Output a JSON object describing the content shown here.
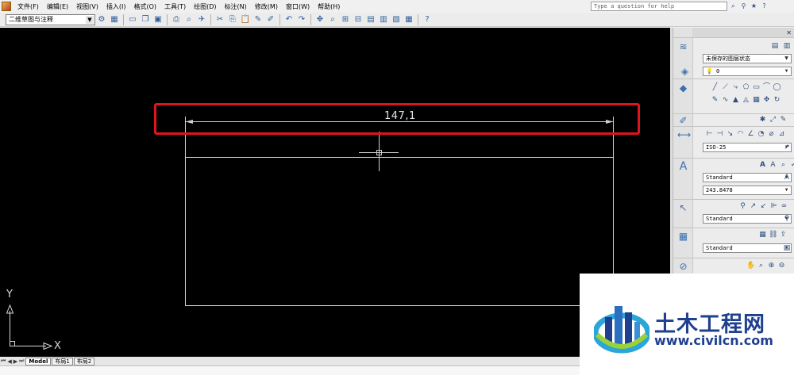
{
  "menu": {
    "items": [
      "文件(F)",
      "编辑(E)",
      "视图(V)",
      "插入(I)",
      "格式(O)",
      "工具(T)",
      "绘图(D)",
      "标注(N)",
      "修改(M)",
      "窗口(W)",
      "帮助(H)"
    ],
    "help_placeholder": "Type a question for help"
  },
  "toolbar": {
    "workspace": "二维草图与注释"
  },
  "canvas": {
    "dimension_text": "147,1",
    "ucs_x": "X",
    "ucs_y": "Y"
  },
  "tabs": {
    "model": "Model",
    "layout1": "布局1",
    "layout2": "布局2"
  },
  "panel": {
    "layer_state": "未保存的图层状态",
    "layer_current": "0",
    "dim_style": "ISO-25",
    "text_style": "Standard",
    "text_height": "243.8478",
    "mleader_style": "Standard",
    "table_style": "Standard"
  },
  "watermark": {
    "title": "土木工程网",
    "url": "www.civilcn.com"
  },
  "colors": {
    "canvas_bg": "#000000",
    "highlight": "#e0141e",
    "brand": "#1f3f8f"
  }
}
